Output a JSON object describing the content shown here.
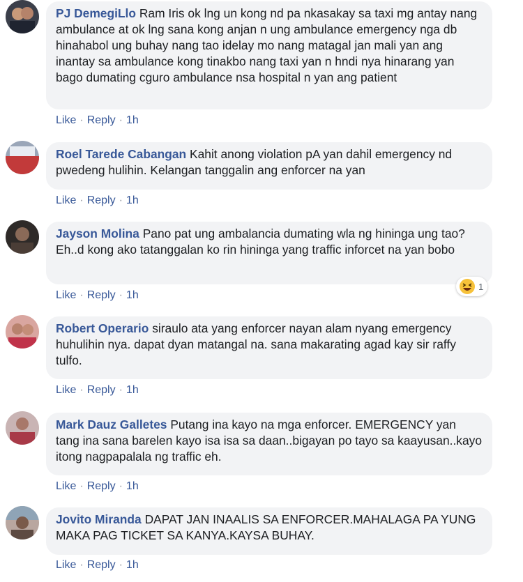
{
  "actions": {
    "like": "Like",
    "reply": "Reply",
    "separator": "·"
  },
  "comments": [
    {
      "author": "PJ DemegiLlo",
      "text": "Ram Iris ok lng un kong nd pa nkasakay sa taxi mg antay nang ambulance at ok lng sana kong anjan n ung ambulance emergency nga db hinahabol ung buhay nang tao idelay mo nang matagal jan mali yan ang inantay sa ambulance kong tinakbo nang taxi yan n hndi nya hinarang yan bago dumating cguro ambulance nsa hospital n yan ang patient",
      "time": "1h"
    },
    {
      "author": "Roel Tarede Cabangan",
      "text": "Kahit anong violation pA yan dahil emergency nd pwedeng hulihin. Kelangan tanggalin ang enforcer na yan",
      "time": "1h"
    },
    {
      "author": "Jayson Molina",
      "text": "Pano pat ung ambalancia dumating wla ng hininga ung tao? Eh..d kong ako tatanggalan ko rin hininga yang traffic inforcet na yan bobo",
      "time": "1h",
      "reaction": {
        "icon": "haha-emoji-icon",
        "count": "1"
      }
    },
    {
      "author": "Robert Operario",
      "text": "siraulo ata yang enforcer nayan alam nyang emergency huhulihin nya. dapat dyan matangal na. sana makarating agad kay sir raffy tulfo.",
      "time": "1h"
    },
    {
      "author": "Mark Dauz Galletes",
      "text": "Putang ina kayo na mga enforcer. EMERGENCY yan tang ina sana barelen kayo isa isa sa daan..bigayan po tayo sa kaayusan..kayo itong nagpapalala ng traffic eh.",
      "time": "1h"
    },
    {
      "author": "Jovito Miranda",
      "text": "DAPAT JAN INAALIS SA ENFORCER.MAHALAGA PA YUNG MAKA PAG TICKET SA KANYA.KAYSA BUHAY.",
      "time": "1h"
    }
  ],
  "colors": {
    "author": "#385898",
    "bubble": "#f2f3f5",
    "text": "#1c1e21"
  }
}
